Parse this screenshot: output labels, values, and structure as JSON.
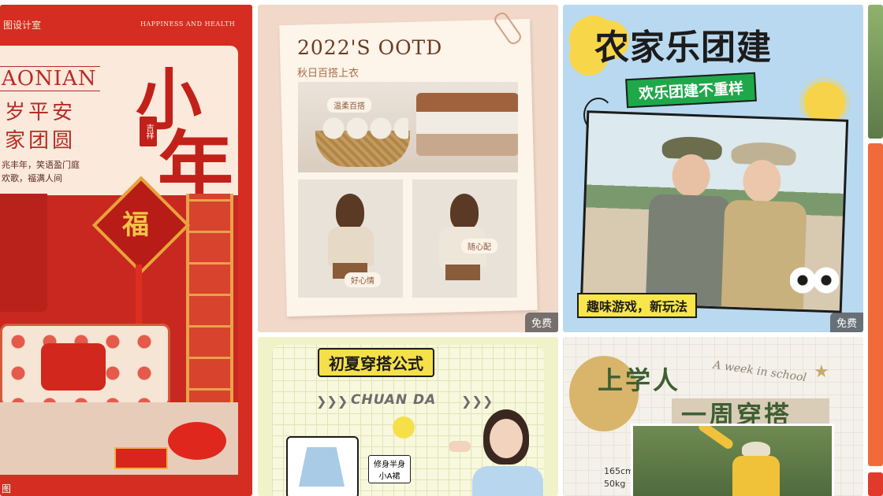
{
  "colors": {
    "red_bg": "#d62d22",
    "cream": "#f8ecdf",
    "peach": "#f1d8c8",
    "sky": "#b9d9f0",
    "green_label": "#22a844",
    "yellow": "#f8e64a",
    "light_yellow": "#f3f5cf",
    "free_badge": "#555555"
  },
  "cards": [
    {
      "id": "new-year",
      "brand": "图设计室",
      "tagline": "HAPPINESS AND HEALTH",
      "pinyin": "AONIAN",
      "line1": "岁平安",
      "line2": "家团圆",
      "body1": "兆丰年，笑语盈门庭",
      "body2": "欢歌，福满人间",
      "big1": "小",
      "big2": "年",
      "seal": "吉祥",
      "fu": "福",
      "bottom": "图"
    },
    {
      "id": "ootd",
      "title": "2022'S OOTD",
      "subtitle": "秋日百搭上衣",
      "tag1": "温柔百搭",
      "tag2": "好心情",
      "tag3": "随心配",
      "badge": "免费"
    },
    {
      "id": "team-building",
      "title": "农家乐团建",
      "subtitle": "欢乐团建不重样",
      "caption": "趣味游戏，新玩法",
      "badge": "免费"
    },
    {
      "id": "summer-outfit",
      "title": "初夏穿搭公式",
      "banner": "CHUAN DA",
      "label1": "修身半身",
      "label2": "小A裙"
    },
    {
      "id": "school-week",
      "title1": "上学人",
      "title2": "一周穿搭",
      "script": "A week in school",
      "stats1": "165cm",
      "stats2": "50kg"
    }
  ]
}
